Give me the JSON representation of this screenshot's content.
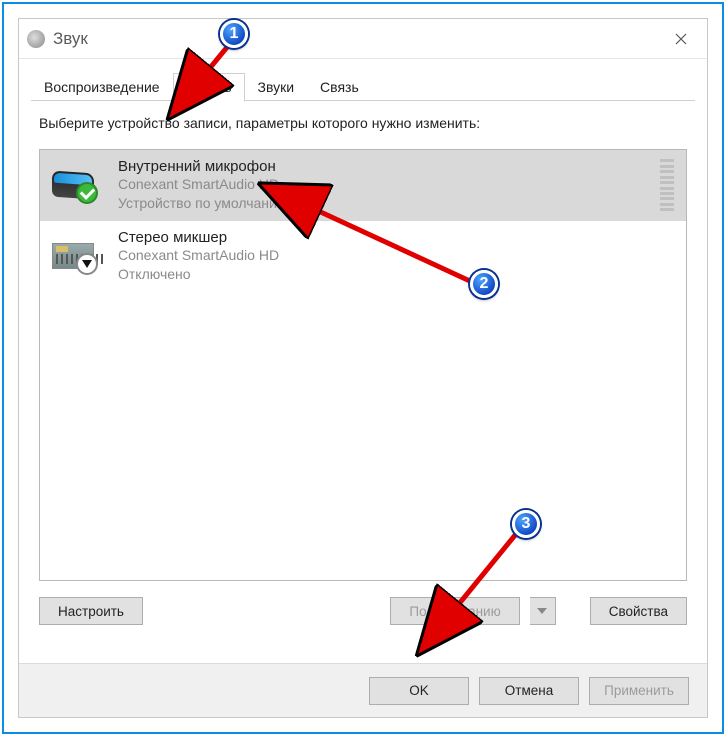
{
  "window": {
    "title": "Звук"
  },
  "tabs": {
    "playback": "Воспроизведение",
    "record": "Запись",
    "sounds": "Звуки",
    "comm": "Связь"
  },
  "instruction": "Выберите устройство записи, параметры которого нужно изменить:",
  "devices": [
    {
      "name": "Внутренний микрофон",
      "sub1": "Conexant SmartAudio HD",
      "sub2": "Устройство по умолчанию"
    },
    {
      "name": "Стерео микшер",
      "sub1": "Conexant SmartAudio HD",
      "sub2": "Отключено"
    }
  ],
  "buttons": {
    "configure": "Настроить",
    "set_default": "По умолчанию",
    "properties": "Свойства",
    "ok": "OK",
    "cancel": "Отмена",
    "apply": "Применить"
  },
  "callouts": {
    "c1": "1",
    "c2": "2",
    "c3": "3"
  }
}
